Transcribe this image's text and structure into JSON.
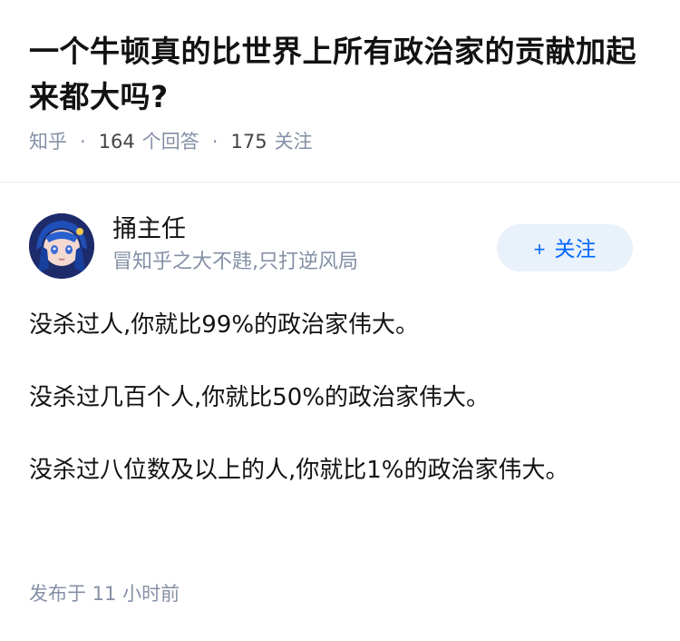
{
  "question": {
    "title": "一个牛顿真的比世界上所有政治家的贡献加起来都大吗?",
    "source": "知乎",
    "answer_count": "164",
    "answer_label": "个回答",
    "follow_count": "175",
    "follow_label": "关注",
    "separator": "·"
  },
  "answer": {
    "author": {
      "name": "捅主任",
      "bio": "冒知乎之大不韪,只打逆风局",
      "avatar_icon": "anime-avatar"
    },
    "follow_button": {
      "icon": "+",
      "label": "关注"
    },
    "paragraphs": [
      "没杀过人,你就比99%的政治家伟大。",
      "没杀过几百个人,你就比50%的政治家伟大。",
      "没杀过八位数及以上的人,你就比1%的政治家伟大。"
    ],
    "published": "发布于  11 小时前"
  },
  "colors": {
    "text": "#121212",
    "muted": "#8590a6",
    "accent": "#0066ff",
    "button_bg": "#e9f1fb"
  }
}
